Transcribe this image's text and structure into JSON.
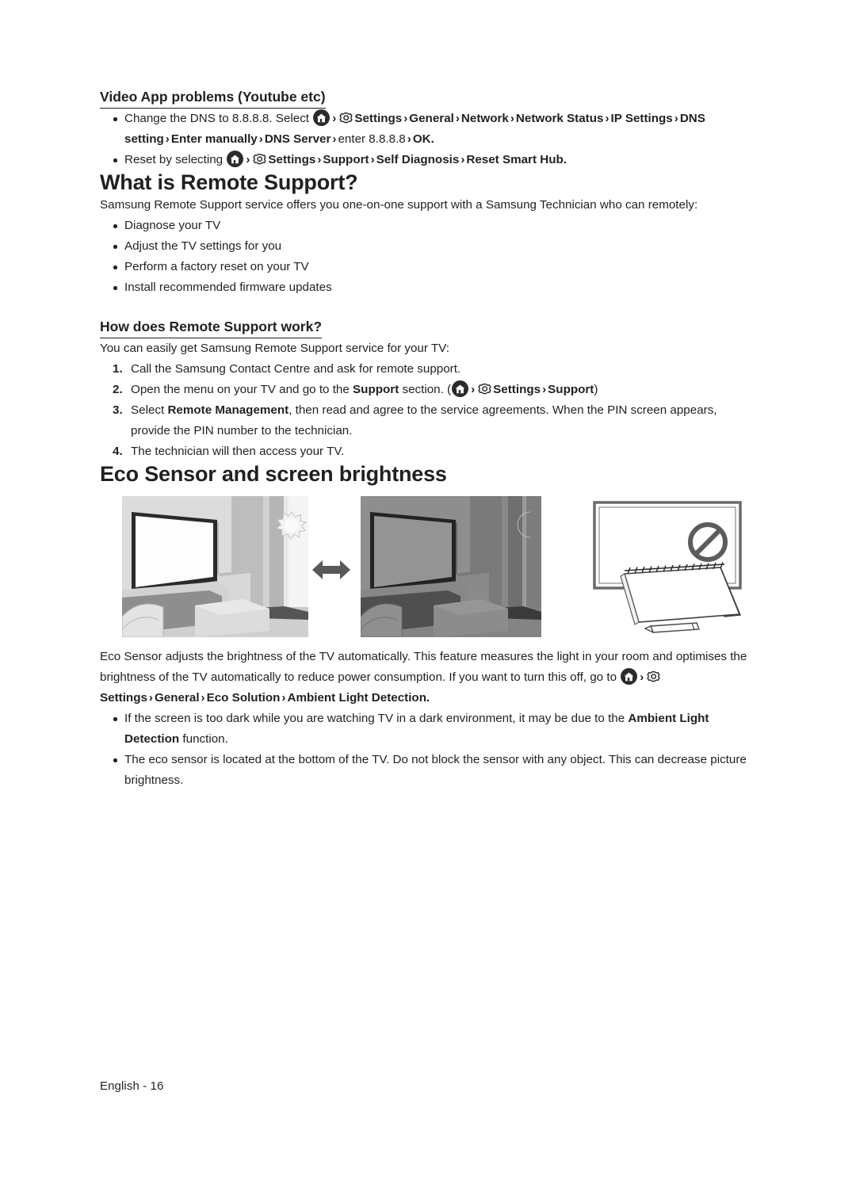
{
  "document": {
    "footer": "English - 16"
  },
  "video_app": {
    "heading": "Video App problems (Youtube etc)",
    "bullets": [
      {
        "pre": "Change the DNS to 8.8.8.8. Select ",
        "home_icon": "home-icon",
        "gear_icon": "gear-icon",
        "trail": [
          {
            "text": "Settings",
            "bold": true
          },
          {
            "text": "General",
            "bold": true
          },
          {
            "text": "Network",
            "bold": true
          },
          {
            "text": "Network Status",
            "bold": true
          },
          {
            "text": "IP Settings",
            "bold": true
          },
          {
            "text": "DNS setting",
            "bold": true
          },
          {
            "text": "Enter manually",
            "bold": true
          },
          {
            "text": "DNS Server",
            "bold": true
          },
          {
            "text": "enter 8.8.8.8",
            "bold": false
          },
          {
            "text": "OK.",
            "bold": true
          }
        ]
      },
      {
        "pre": "Reset by selecting ",
        "home_icon": "home-icon",
        "gear_icon": "gear-icon",
        "trail": [
          {
            "text": "Settings",
            "bold": true
          },
          {
            "text": "Support",
            "bold": true
          },
          {
            "text": "Self Diagnosis",
            "bold": true
          },
          {
            "text": "Reset Smart Hub.",
            "bold": true
          }
        ]
      }
    ]
  },
  "remote_support": {
    "heading": "What is Remote Support?",
    "intro": "Samsung Remote Support service offers you one-on-one support with a Samsung Technician who can remotely:",
    "bullets": [
      "Diagnose your TV",
      "Adjust the TV settings for you",
      "Perform a factory reset on your TV",
      "Install recommended firmware updates"
    ]
  },
  "how_it_works": {
    "heading": "How does Remote Support work?",
    "intro": "You can easily get Samsung Remote Support service for your TV:",
    "steps": {
      "step1": "Call the Samsung Contact Centre and ask for remote support.",
      "step2_a": "Open the menu on your TV and go to the ",
      "step2_bold": "Support",
      "step2_b": " section. (",
      "step2_settings": "Settings",
      "step2_support": "Support",
      "step2_close": ")",
      "step3_a": "Select ",
      "step3_bold": "Remote Management",
      "step3_b": ", then read and agree to the service agreements. When the PIN screen appears, provide the PIN number to the technician.",
      "step4": "The technician will then access your TV."
    }
  },
  "eco_sensor": {
    "heading": "Eco Sensor and screen brightness",
    "figures": {
      "bright_room": "bright-room-illustration",
      "dark_room": "dark-room-illustration",
      "do-not-block": "tv-do-not-block-illustration",
      "arrow": "double-arrow-icon",
      "sun": "sun-icon",
      "moon": "moon-icon",
      "prohibition": "prohibition-icon"
    },
    "paragraph_a": "Eco Sensor adjusts the brightness of the TV automatically. This feature measures the light in your room and optimises the brightness of the TV automatically to reduce power consumption. If you want to turn this off, go to ",
    "path": [
      {
        "text": "Settings",
        "bold": true
      },
      {
        "text": "General",
        "bold": true
      },
      {
        "text": "Eco Solution",
        "bold": true
      },
      {
        "text": "Ambient Light Detection.",
        "bold": true
      }
    ],
    "bullets": {
      "b1_a": "If the screen is too dark while you are watching TV in a dark environment, it may be due to the ",
      "b1_bold": "Ambient Light Detection",
      "b1_b": " function.",
      "b2": "The eco sensor is located at the bottom of the TV. Do not block the sensor with any object. This can decrease picture brightness."
    }
  },
  "colors": {
    "text": "#231f20",
    "home_icon_bg": "#2b2b2b",
    "page_bg": "#ffffff"
  }
}
